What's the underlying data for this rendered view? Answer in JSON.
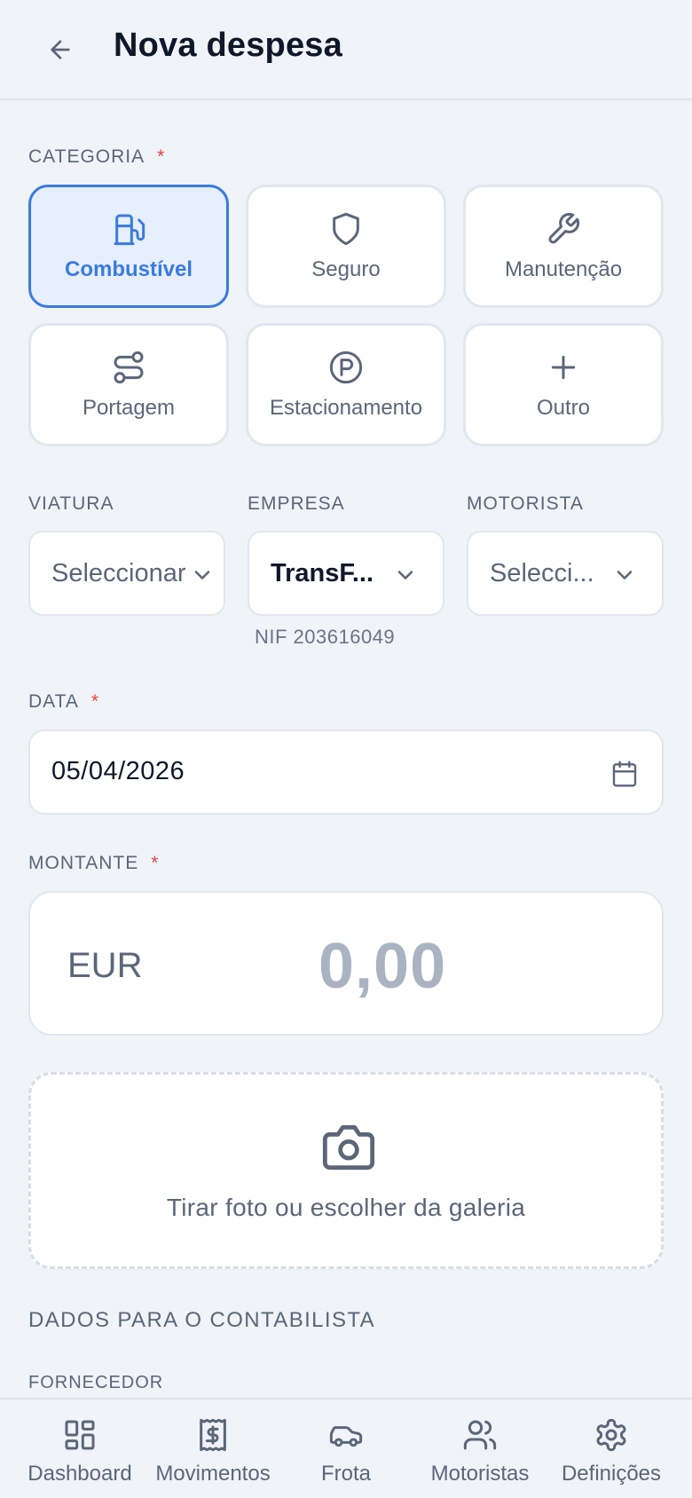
{
  "header": {
    "title": "Nova despesa",
    "back_icon": "arrow-left-icon"
  },
  "category": {
    "label": "CATEGORIA",
    "required_mark": "*",
    "selected": "Combustível",
    "items": [
      {
        "label": "Combustível",
        "icon": "fuel-pump-icon"
      },
      {
        "label": "Seguro",
        "icon": "shield-icon"
      },
      {
        "label": "Manutenção",
        "icon": "wrench-icon"
      },
      {
        "label": "Portagem",
        "icon": "route-icon"
      },
      {
        "label": "Estacionamento",
        "icon": "parking-icon"
      },
      {
        "label": "Outro",
        "icon": "plus-icon"
      }
    ]
  },
  "selectors": {
    "viatura": {
      "label": "VIATURA",
      "value": "Seleccionar"
    },
    "empresa": {
      "label": "EMPRESA",
      "value": "TransF...",
      "nif": "NIF 203616049"
    },
    "motorista": {
      "label": "MOTORISTA",
      "value": "Selecci..."
    }
  },
  "date": {
    "label": "DATA",
    "required_mark": "*",
    "value": "05/04/2026"
  },
  "amount": {
    "label": "MONTANTE",
    "required_mark": "*",
    "currency": "EUR",
    "placeholder": "0,00"
  },
  "photo": {
    "text": "Tirar foto ou escolher da galeria"
  },
  "accountant": {
    "title": "DADOS PARA O CONTABILISTA",
    "supplier_label": "FORNECEDOR"
  },
  "nav": [
    {
      "label": "Dashboard",
      "icon": "dashboard-icon"
    },
    {
      "label": "Movimentos",
      "icon": "receipt-icon"
    },
    {
      "label": "Frota",
      "icon": "car-icon"
    },
    {
      "label": "Motoristas",
      "icon": "users-icon"
    },
    {
      "label": "Definições",
      "icon": "gear-icon"
    }
  ],
  "colors": {
    "accent": "#3a7be0",
    "required": "#e04444",
    "muted": "#5b6678",
    "background": "#f0f3f8"
  }
}
